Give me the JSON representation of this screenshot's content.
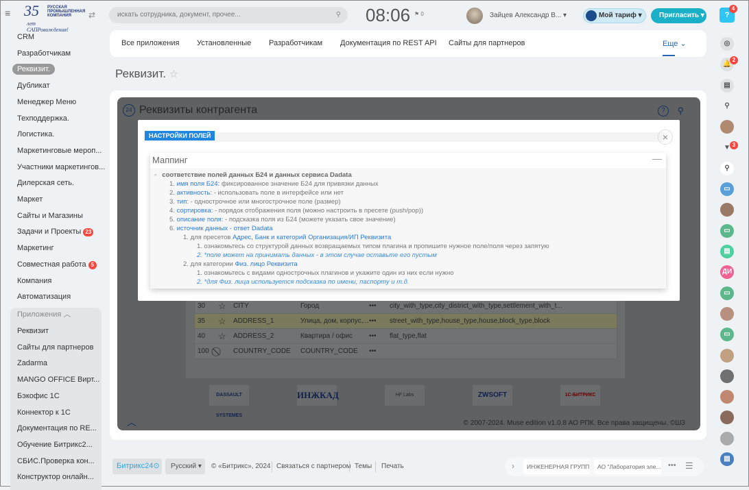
{
  "header": {
    "logo_text": "35 лет САПРовождения! Русская Промышленная Компания",
    "search_placeholder": "искать сотрудника, документ, прочее...",
    "clock": "08:06",
    "flag_count": "0",
    "user_name": "Зайцев Александр В...",
    "tariff_label": "Мой тариф",
    "invite_label": "Пригласить",
    "help_badge": "4"
  },
  "sidebar": {
    "items": [
      {
        "label": "CRM"
      },
      {
        "label": "Разработчикам"
      },
      {
        "label": "Реквизит.",
        "active": true
      },
      {
        "label": "Дубликат"
      },
      {
        "label": "Менеджер Меню"
      },
      {
        "label": "Техподдержка."
      },
      {
        "label": "Логистика."
      },
      {
        "label": "Маркетинговые мероп..."
      },
      {
        "label": "Участники маркетингов..."
      },
      {
        "label": "Дилерская сеть."
      },
      {
        "label": "Маркет"
      },
      {
        "label": "Сайты и Магазины"
      },
      {
        "label": "Задачи и Проекты",
        "badge": "23"
      },
      {
        "label": "Маркетинг"
      },
      {
        "label": "Совместная работа",
        "badge": "5"
      },
      {
        "label": "Компания"
      },
      {
        "label": "Автоматизация"
      }
    ],
    "group_label": "Приложения",
    "group_items": [
      {
        "label": "Реквизит"
      },
      {
        "label": "Сайты для партнеров"
      },
      {
        "label": "Zadarma"
      },
      {
        "label": "MANGO OFFICE Вирт..."
      },
      {
        "label": "Бэкофис 1С"
      },
      {
        "label": "Коннектор к 1С"
      },
      {
        "label": "Документация по RE..."
      },
      {
        "label": "Обучение Битрикс2..."
      },
      {
        "label": "СБИС.Проверка кон..."
      },
      {
        "label": "Конструктор онлайн..."
      }
    ]
  },
  "topnav": {
    "items": [
      "Все приложения",
      "Установленные",
      "Разработчикам",
      "Документация по REST API",
      "Сайты для партнеров"
    ],
    "more": "Еще"
  },
  "page_title": "Реквизит.",
  "app": {
    "title": "Реквизиты контрагента",
    "rows": [
      {
        "sort": "30",
        "code": "CITY",
        "name": "Город",
        "source": "city_with_type,city_district_with_type,settlement_with_t..."
      },
      {
        "sort": "35",
        "code": "ADDRESS_1",
        "name": "Улица, дом, корпус,...",
        "source": "street_with_type,house_type,house,block_type,block"
      },
      {
        "sort": "40",
        "code": "ADDRESS_2",
        "name": "Квартира / офис",
        "source": "flat_type,flat"
      },
      {
        "sort": "100",
        "code": "COUNTRY_CODE",
        "name": "COUNTRY_CODE",
        "source": ""
      }
    ],
    "partners": [
      "DASSAULT SYSTEMES",
      "ИНЖКАД",
      "HF Labs",
      "ZWSOFT",
      "1С-БИТРИКС"
    ],
    "copyright": "© 2007-2024. Muse edition v1.0.8 АО РПК. Все права защищены. ©Ш3"
  },
  "dialog": {
    "tag": "НАСТРОЙКИ ПОЛЕЙ",
    "panel_title": "Маппинг",
    "heading": "соответствие полей данных Б24 и данных сервиса Dadata",
    "items": [
      {
        "n": "1.",
        "key": "имя поля Б24:",
        "text": " фиксированное значение Б24 для привязки данных"
      },
      {
        "n": "2.",
        "key": "активность:",
        "text": " - использовать поле в интерфейсе или нет"
      },
      {
        "n": "3.",
        "key": "тип:",
        "text": " - однострочное или многострочное поле (размер)"
      },
      {
        "n": "4.",
        "key": "сортировка:",
        "text": " - порядок отображения поля (можно настроить в пресете (push/pop))"
      },
      {
        "n": "5.",
        "key": "описание поля:",
        "text": " - подсказка поля из Б24 (можете указать свое значение)"
      },
      {
        "n": "6.",
        "key": "источник данных - ответ Dadata",
        "text": ""
      }
    ],
    "sub1": {
      "n": "1.",
      "prefix": "для пресетов ",
      "link": "Адрес, Банк и категорий Организация/ИП Реквизита",
      "a": "1. ознакомьтесь со структурой данных возвращаемых типом плагина и пропишите нужное поле/поля через запятую",
      "b": "2. *поле может на принимать данных - в этом случае оставьте его пустым"
    },
    "sub2": {
      "n": "2.",
      "prefix": "для категории ",
      "link": "Физ. лицо Реквизита",
      "a": "1. ознакомьтесь с видами однострочных плагинов и укажите один из них если нужно",
      "b": "2. *для Физ. лица используется подсказка по имени, паспорту и т.д."
    }
  },
  "footer": {
    "brand": "Битрикс24",
    "lang": "Русский",
    "copyright": "© «Битрикс», 2024",
    "links": [
      "Связаться с партнером",
      "Темы",
      "Печать"
    ],
    "tasks": [
      "ИНЖЕНЕРНАЯ ГРУПП...",
      "АО \"Лаборатория эле..."
    ]
  },
  "right_bar": {
    "notif_badge": "2",
    "item_badge": "3",
    "initials": "ДИ"
  }
}
